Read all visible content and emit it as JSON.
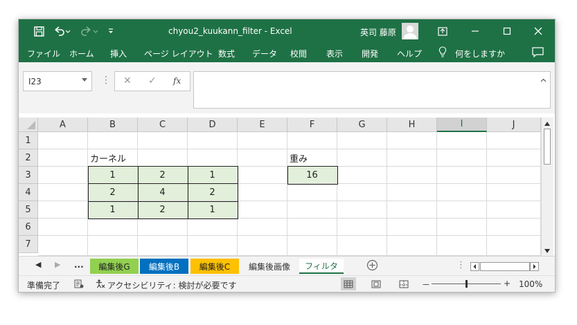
{
  "window": {
    "title": "chyou2_kuukann_filter  -  Excel",
    "user_name": "英司 藤原",
    "save_icon": "save-icon",
    "undo_icon": "undo-icon",
    "redo_icon": "redo-icon",
    "ribbon_display_icon": "ribbon-display-options-icon",
    "minimize_icon": "minimize-icon",
    "maximize_icon": "maximize-icon",
    "close_icon": "close-icon"
  },
  "menu": {
    "items": [
      "ファイル",
      "ホーム",
      "挿入",
      "ページ レイアウト",
      "数式",
      "データ",
      "校閲",
      "表示",
      "開発",
      "ヘルプ"
    ],
    "tell_me": "何をしますか",
    "tell_me_icon": "lightbulb-icon",
    "comment_icon": "comment-icon"
  },
  "formula_bar": {
    "name_box": "I23",
    "cancel_glyph": "✕",
    "enter_glyph": "✓",
    "fx_glyph": "fx",
    "value": ""
  },
  "grid": {
    "columns": [
      "A",
      "B",
      "C",
      "D",
      "E",
      "F",
      "G",
      "H",
      "I",
      "J"
    ],
    "selected_column": "I",
    "rows": [
      "1",
      "2",
      "3",
      "4",
      "5",
      "6",
      "7"
    ],
    "kernel_label": "カーネル",
    "weight_label": "重み",
    "kernel": [
      [
        "1",
        "2",
        "1"
      ],
      [
        "2",
        "4",
        "2"
      ],
      [
        "1",
        "2",
        "1"
      ]
    ],
    "weight": "16"
  },
  "sheet_tabs": {
    "more": "...",
    "tabs": [
      "編集後G",
      "編集後B",
      "編集後C",
      "編集後画像",
      "フィルタ"
    ],
    "active_tab": "フィルタ",
    "tab_colors": {
      "編集後G": "#92d050",
      "編集後B": "#0070c0",
      "編集後C": "#ffc000"
    }
  },
  "status": {
    "ready": "準備完了",
    "accessibility": "アクセシビリティ: 検討が必要です",
    "zoom": "100%",
    "zoom_minus": "－",
    "zoom_plus": "+"
  }
}
